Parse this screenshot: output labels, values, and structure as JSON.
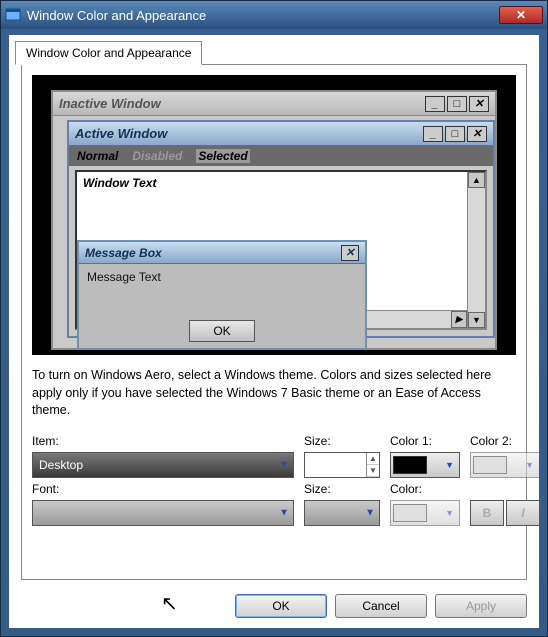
{
  "window": {
    "title": "Window Color and Appearance",
    "tab_label": "Window Color and Appearance"
  },
  "preview": {
    "inactive_title": "Inactive Window",
    "active_title": "Active Window",
    "menu": {
      "normal": "Normal",
      "disabled": "Disabled",
      "selected": "Selected"
    },
    "window_text": "Window Text",
    "msgbox_title": "Message Box",
    "msgbox_text": "Message Text",
    "ok": "OK"
  },
  "hint": "To turn on Windows Aero, select a Windows theme.  Colors and sizes selected here apply only if you have selected the Windows 7 Basic theme or an Ease of Access theme.",
  "labels": {
    "item": "Item:",
    "size": "Size:",
    "color1": "Color 1:",
    "color2": "Color 2:",
    "font": "Font:",
    "color": "Color:"
  },
  "values": {
    "item_selected": "Desktop",
    "item_size": "",
    "font_selected": "",
    "font_size": "",
    "color1_swatch": "#000000",
    "bold": "B",
    "italic": "I"
  },
  "buttons": {
    "ok": "OK",
    "cancel": "Cancel",
    "apply": "Apply"
  }
}
